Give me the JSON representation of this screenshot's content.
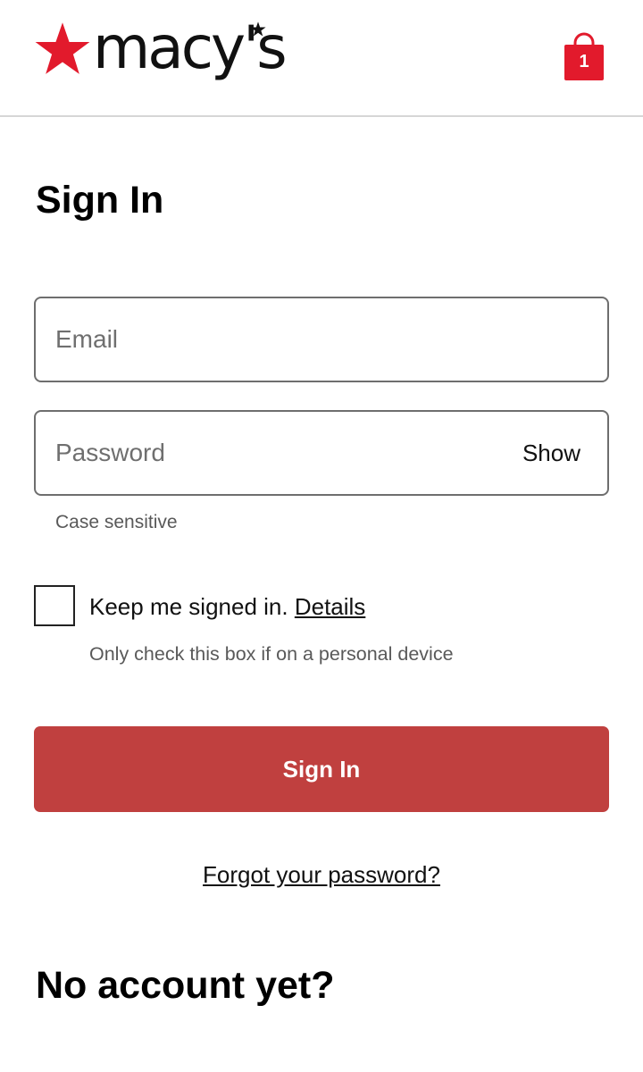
{
  "header": {
    "logo_text": "macy's",
    "logo_icon": "star-icon",
    "bag_icon": "shopping-bag-icon",
    "bag_count": "1",
    "brand_color": "#e21a2c"
  },
  "form": {
    "title": "Sign In",
    "email_placeholder": "Email",
    "email_value": "",
    "password_placeholder": "Password",
    "password_value": "",
    "show_label": "Show",
    "case_note": "Case sensitive",
    "keep_signed_in_label": "Keep me signed in.",
    "details_link": "Details",
    "keep_signed_in_checked": false,
    "keep_note": "Only check this box if on a personal device",
    "signin_button": "Sign In",
    "signin_button_color": "#c0403f",
    "forgot_link": "Forgot your password?"
  },
  "register": {
    "heading": "No account yet?"
  }
}
